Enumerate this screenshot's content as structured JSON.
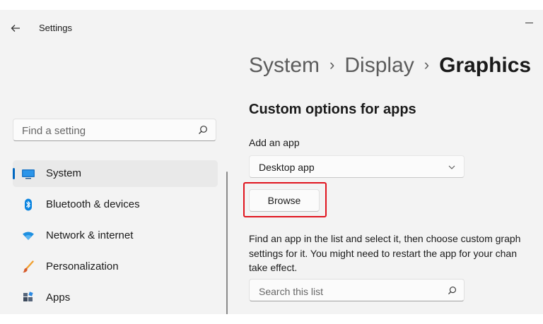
{
  "window": {
    "title": "Settings"
  },
  "sidebar": {
    "search_placeholder": "Find a setting",
    "items": [
      {
        "label": "System",
        "icon": "monitor-icon",
        "active": true
      },
      {
        "label": "Bluetooth & devices",
        "icon": "bluetooth-icon",
        "active": false
      },
      {
        "label": "Network & internet",
        "icon": "wifi-icon",
        "active": false
      },
      {
        "label": "Personalization",
        "icon": "brush-icon",
        "active": false
      },
      {
        "label": "Apps",
        "icon": "apps-icon",
        "active": false
      }
    ]
  },
  "breadcrumb": {
    "items": [
      "System",
      "Display",
      "Graphics"
    ],
    "separator": "›"
  },
  "content": {
    "section_title": "Custom options for apps",
    "add_app_label": "Add an app",
    "dropdown_value": "Desktop app",
    "browse_label": "Browse",
    "description_lines": [
      "Find an app in the list and select it, then choose custom graph",
      "settings for it. You might need to restart the app for your chan",
      "take effect."
    ],
    "list_search_placeholder": "Search this list"
  },
  "colors": {
    "accent": "#0067c0",
    "highlight_border": "#e0141e",
    "window_bg": "#f3f3f3"
  }
}
